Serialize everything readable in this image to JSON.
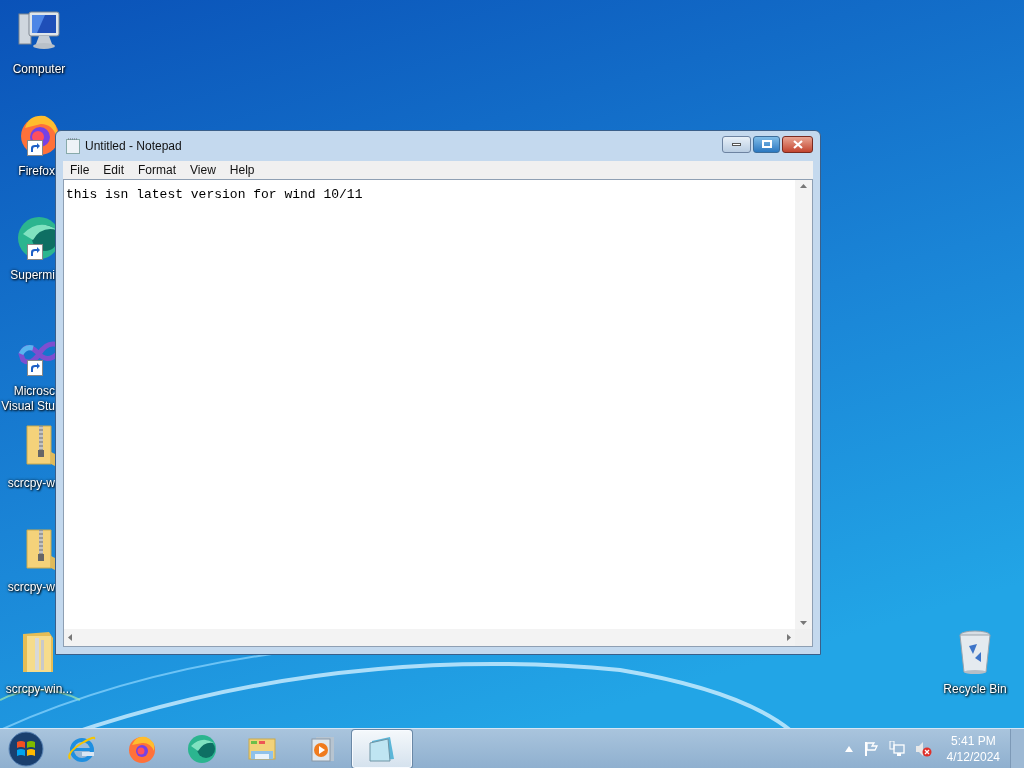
{
  "desktop_icons": [
    {
      "kind": "computer",
      "lines": [
        "Computer"
      ],
      "clipped": false
    },
    {
      "kind": "firefox",
      "lines": [
        "Firefox"
      ],
      "clipped": true
    },
    {
      "kind": "supermium",
      "lines": [
        "Supermi"
      ],
      "clipped": true
    },
    {
      "kind": "visualstudio",
      "lines": [
        "Microsc",
        "Visual Stu"
      ],
      "clipped": true
    },
    {
      "kind": "zip",
      "lines": [
        "scrcpy-w"
      ],
      "clipped": true
    },
    {
      "kind": "zip",
      "lines": [
        "scrcpy-w"
      ],
      "clipped": true
    },
    {
      "kind": "folder",
      "lines": [
        "scrcpy-win..."
      ],
      "clipped": false
    },
    {
      "kind": "recycle",
      "lines": [
        "Recycle Bin"
      ],
      "clipped": false
    }
  ],
  "window": {
    "title": "Untitled - Notepad",
    "menu": [
      "File",
      "Edit",
      "Format",
      "View",
      "Help"
    ],
    "text": "this isn latest version for wind 10/11",
    "maximize_hovered": true
  },
  "taskbar": {
    "items": [
      {
        "kind": "start",
        "active": false
      },
      {
        "kind": "ie",
        "active": false
      },
      {
        "kind": "firefox",
        "active": false
      },
      {
        "kind": "supermium",
        "active": false
      },
      {
        "kind": "explorer",
        "active": false
      },
      {
        "kind": "media",
        "active": false
      },
      {
        "kind": "notepad",
        "active": true
      }
    ],
    "tray": [
      {
        "kind": "caret"
      },
      {
        "kind": "flag"
      },
      {
        "kind": "network"
      },
      {
        "kind": "volume-muted"
      }
    ],
    "clock": {
      "time": "5:41 PM",
      "date": "4/12/2024"
    }
  }
}
